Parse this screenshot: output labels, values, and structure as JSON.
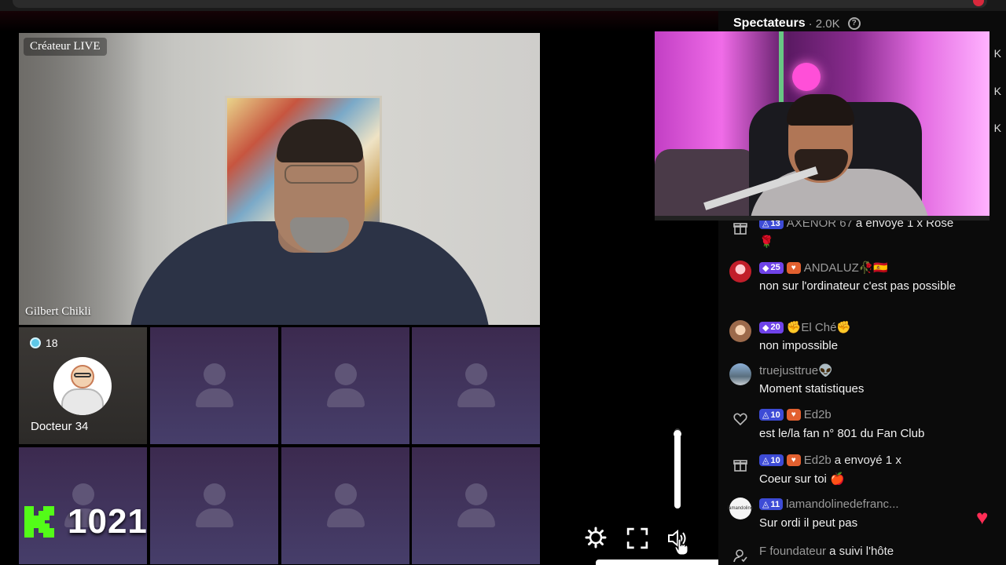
{
  "host": {
    "badge": "Créateur LIVE",
    "name": "Gilbert Chikli"
  },
  "guest_tile": {
    "count": "18",
    "name": "Docteur 34"
  },
  "kick": {
    "viewer_count": "1021"
  },
  "controls": {
    "volume_level": 0.93
  },
  "panel": {
    "title": "Spectateurs",
    "count": "· 2.0K",
    "help_icon": "?",
    "side_letters": [
      "K",
      "K",
      "K"
    ]
  },
  "chat": [
    {
      "icon": "gift-icon",
      "level": "13",
      "user": "AXENOR 67",
      "action": "a envoyé 1 x Rose",
      "emoji": "🌹"
    },
    {
      "icon": "avatar",
      "level": "25",
      "fan": true,
      "user": "ANDALUZ🥀🇪🇸",
      "body": "non sur l'ordinateur c'est pas possible"
    },
    {
      "icon": "avatar",
      "level": "20",
      "user": "✊El Ché✊",
      "body": "non impossible"
    },
    {
      "icon": "avatar",
      "user": "truejusttrue👽",
      "body": "Moment statistiques"
    },
    {
      "icon": "heart-outline-icon",
      "level": "10",
      "fan": true,
      "user": "Ed2b",
      "body": "est le/la fan n° 801 du Fan Club"
    },
    {
      "icon": "gift-icon",
      "level": "10",
      "fan": true,
      "user": "Ed2b",
      "action": "a envoyé 1 x",
      "body": "Coeur sur toi 🍎"
    },
    {
      "icon": "avatar",
      "level": "11",
      "user": "lamandolinedefranc...",
      "body": "Sur ordi il peut pas"
    },
    {
      "icon": "user-follow-icon",
      "user": "F foundateur",
      "action": "a suivi l'hôte"
    }
  ],
  "colors": {
    "kick_green": "#53fc18",
    "level_badge": "#3d4bd6",
    "level_badge_high": "#6f43e9",
    "fan_badge": "#e2602f",
    "heart": "#ff2d55"
  }
}
